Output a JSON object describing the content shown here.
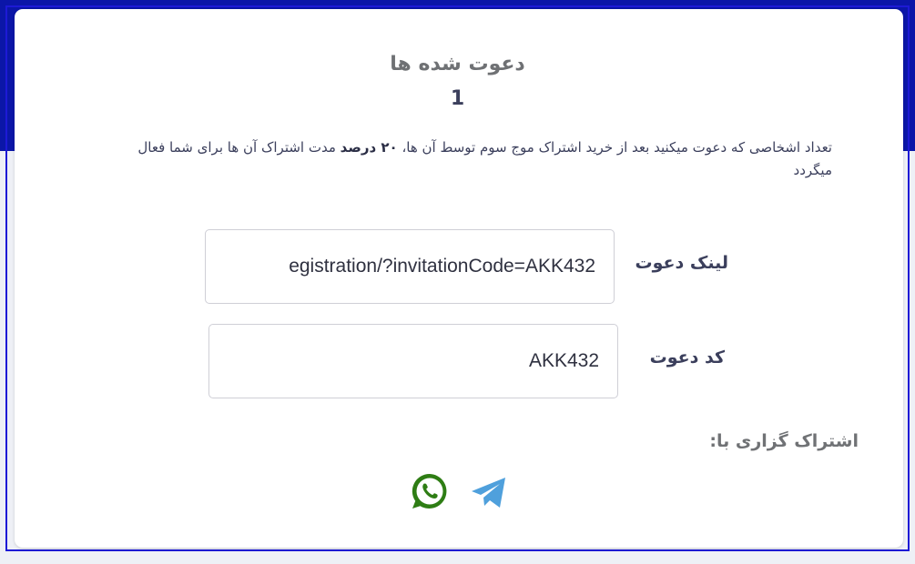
{
  "invited": {
    "title": "دعوت شده ها",
    "count": "1"
  },
  "description": {
    "part1": "تعداد اشخاصی که دعوت میکنید بعد از خرید اشتراک موج سوم توسط آن ها، ",
    "bold": "۲۰ درصد",
    "part2": " مدت اشتراک آن ها برای شما فعال میگردد"
  },
  "invite_link": {
    "label": "لینک دعوت",
    "value": "egistration/?invitationCode=AKK432"
  },
  "invite_code": {
    "label": "کد دعوت",
    "value": "AKK432"
  },
  "share": {
    "label": "اشتراک گزاری با:",
    "icons": [
      "whatsapp-icon",
      "telegram-icon"
    ]
  },
  "colors": {
    "header_band": "#0b16a8",
    "frame_border": "#1d1ad6",
    "whatsapp": "#2e7d14",
    "telegram": "#4fa0dc"
  }
}
